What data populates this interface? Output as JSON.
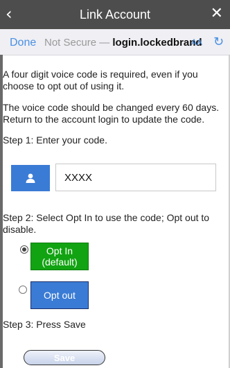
{
  "titlebar": {
    "back_icon": "back-chevron-icon",
    "title": "Link Account",
    "close_icon": "close-icon"
  },
  "addressbar": {
    "done": "Done",
    "not_secure": "Not Secure —",
    "domain": "login.lockedbrand",
    "text_size": "AA",
    "reload_icon": "reload-icon"
  },
  "content": {
    "intro": "A four digit voice code is required, even if you choose to opt out of using it.",
    "rotation": "The voice code should be changed every 60 days. Return to the account login to update the code.",
    "step1": "Step 1: Enter your code.",
    "code_value": "XXXX",
    "user_icon": "user-icon",
    "step2": "Step 2: Select Opt In to use the code; Opt out to disable.",
    "opt_in_label": "Opt In (default)",
    "opt_out_label": "Opt out",
    "opt_in_selected": true,
    "step3": "Step 3: Press Save",
    "save_label": "Save"
  },
  "colors": {
    "titlebar_bg": "#4d4d4d",
    "addressbar_bg": "#efeff4",
    "link_blue": "#4a90e2",
    "user_button_bg": "#3a7bd5",
    "opt_in_bg": "#12a312",
    "opt_out_bg": "#3a7bd5"
  }
}
